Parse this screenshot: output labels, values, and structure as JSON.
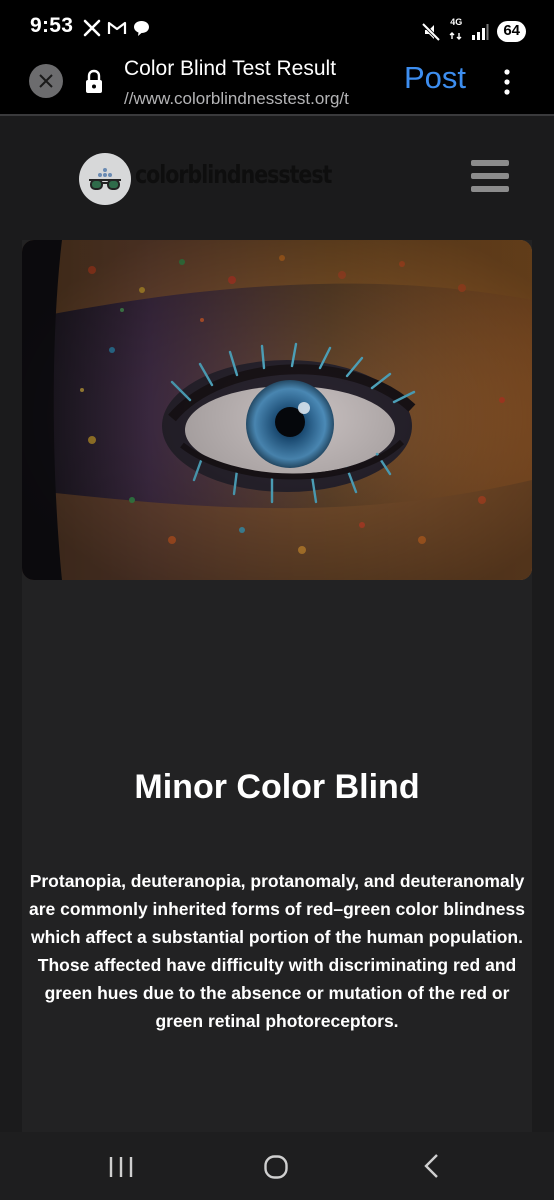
{
  "status_bar": {
    "time": "9:53",
    "left_icons": [
      "x-app-icon",
      "gmail-icon",
      "chat-bubble-icon"
    ],
    "network": "4G",
    "battery": "64",
    "right_icons": [
      "mute-icon",
      "4g-icon",
      "signal-icon",
      "battery-icon"
    ]
  },
  "browser": {
    "title": "Color Blind Test Result",
    "url": "//www.colorblindnesstest.org/t",
    "post_label": "Post"
  },
  "site": {
    "logo_text": "colorblindnesstest"
  },
  "result": {
    "title": "Minor Color Blind",
    "description": "Protanopia, deuteranopia, protanomaly, and deuteranomaly are commonly inherited forms of red–green color blindness which affect a substantial portion of the human population. Those affected have difficulty with discriminating red and green hues due to the absence or mutation of the red or green retinal photoreceptors."
  },
  "colors": {
    "accent": "#3d8ef0",
    "background": "#1b1b1c",
    "card": "#222223"
  }
}
